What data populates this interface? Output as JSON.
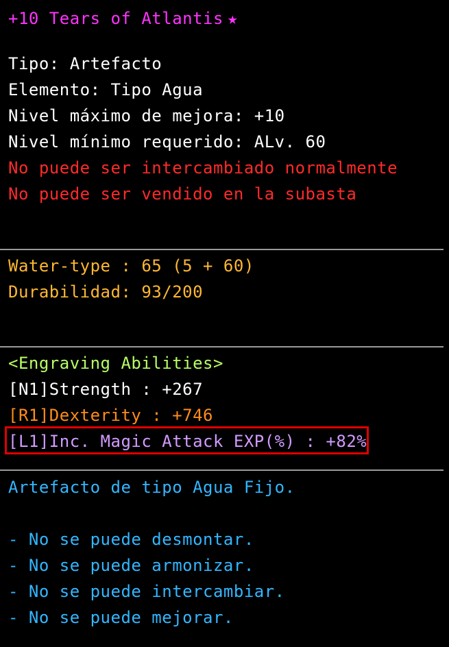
{
  "item": {
    "title": "+10 Tears of Atlantis",
    "star_icon": "star-icon"
  },
  "properties": [
    "Tipo: Artefacto",
    "Elemento: Tipo Agua",
    "Nivel máximo de mejora: +10",
    "Nivel mínimo requerido: ALv. 60"
  ],
  "restrictions": [
    "No puede ser intercambiado normalmente",
    "No puede ser vendido en la subasta"
  ],
  "stats": {
    "element_value": "Water-type : 65 (5 + 60)",
    "durability": "Durabilidad: 93/200"
  },
  "engraving": {
    "header": "<Engraving Abilities>",
    "lines": [
      "[N1]Strength : +267",
      "[R1]Dexterity : +746",
      "[L1]Inc. Magic Attack EXP(%) : +82%"
    ]
  },
  "description": {
    "summary": "Artefacto de tipo Agua Fijo.",
    "notes": [
      "- No se puede desmontar.",
      "- No se puede armonizar.",
      "- No se puede intercambiar.",
      "- No se puede mejorar."
    ]
  },
  "colors": {
    "title": "#ff33ff",
    "restriction": "#ff2a2a",
    "stat": "#ffb733",
    "engraving_header": "#b8ff66",
    "rank_n": "#ffffff",
    "rank_r": "#ff8c1a",
    "rank_l": "#d29bff",
    "description": "#33b6ff",
    "highlight_border": "#e00000"
  }
}
